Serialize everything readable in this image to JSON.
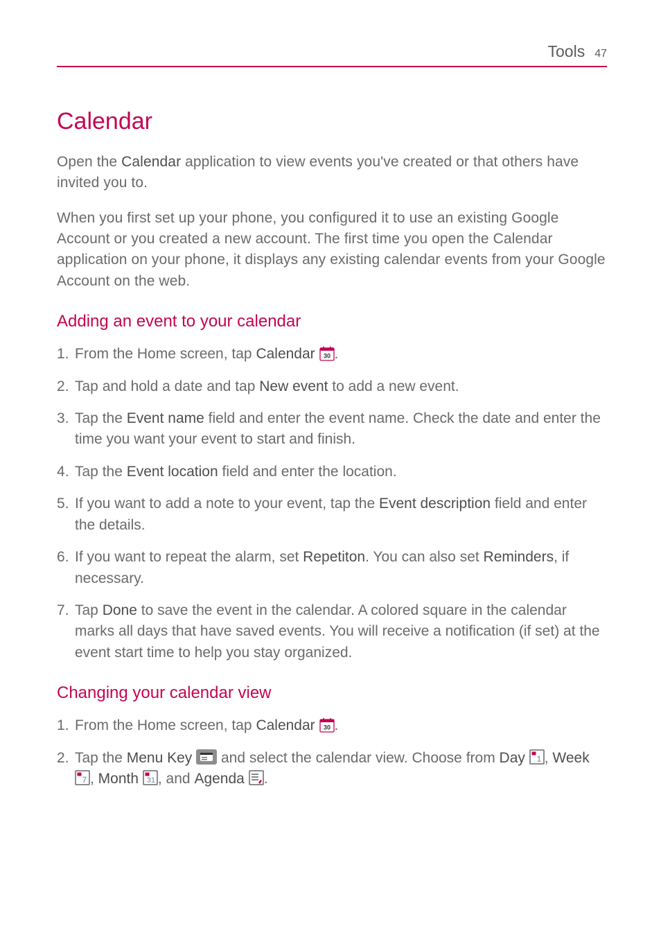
{
  "header": {
    "section": "Tools",
    "page_number": "47"
  },
  "title": "Calendar",
  "intro": {
    "p1_a": "Open the ",
    "p1_b": "Calendar",
    "p1_c": " application to view events you've created or that others have invited you to.",
    "p2": "When you first set up your phone, you configured it to use an existing Google Account or you created a new account. The first time you open the Calendar application on your phone, it displays any existing calendar events from your Google Account on the web."
  },
  "section_adding": {
    "heading": "Adding an event to your calendar",
    "steps": {
      "s1_a": "From the Home screen, tap ",
      "s1_b": "Calendar",
      "s1_c": " ",
      "s1_d": ".",
      "s2_a": "Tap and hold a date and tap ",
      "s2_b": "New event",
      "s2_c": " to add a new event.",
      "s3_a": "Tap the ",
      "s3_b": "Event name",
      "s3_c": " field and enter the event name. Check the date and enter the time you want your event to start and finish.",
      "s4_a": "Tap the ",
      "s4_b": "Event location",
      "s4_c": " field and enter the location.",
      "s5_a": "If you want to add a note to your event, tap the ",
      "s5_b": "Event description",
      "s5_c": " field and enter the details.",
      "s6_a": "If you want to repeat the alarm, set ",
      "s6_b": "Repetiton",
      "s6_c": ". You can also set ",
      "s6_d": "Reminders",
      "s6_e": ", if necessary.",
      "s7_a": "Tap ",
      "s7_b": "Done",
      "s7_c": " to save the event in the calendar. A colored square in the calendar marks all days that have saved events. You will receive a notification (if set) at the event start time to help you stay organized."
    }
  },
  "section_changing": {
    "heading": "Changing your calendar view",
    "steps": {
      "s1_a": "From the Home screen, tap ",
      "s1_b": "Calendar",
      "s1_c": " ",
      "s1_d": ".",
      "s2_a": "Tap the ",
      "s2_b": "Menu Key",
      "s2_c": " ",
      "s2_d": " and select the calendar view. Choose from ",
      "s2_e": "Day",
      "s2_f": " ",
      "s2_g": ", ",
      "s2_h": "Week",
      "s2_i": " ",
      "s2_j": ", ",
      "s2_k": "Month",
      "s2_l": " ",
      "s2_m": ", and ",
      "s2_n": "Agenda",
      "s2_o": " ",
      "s2_p": "."
    }
  },
  "icons": {
    "calendar30": "calendar-30-icon",
    "menu_key": "menu-key-icon",
    "day": "calendar-day-icon",
    "week": "calendar-week-icon",
    "month": "calendar-month-icon",
    "agenda": "calendar-agenda-icon"
  }
}
